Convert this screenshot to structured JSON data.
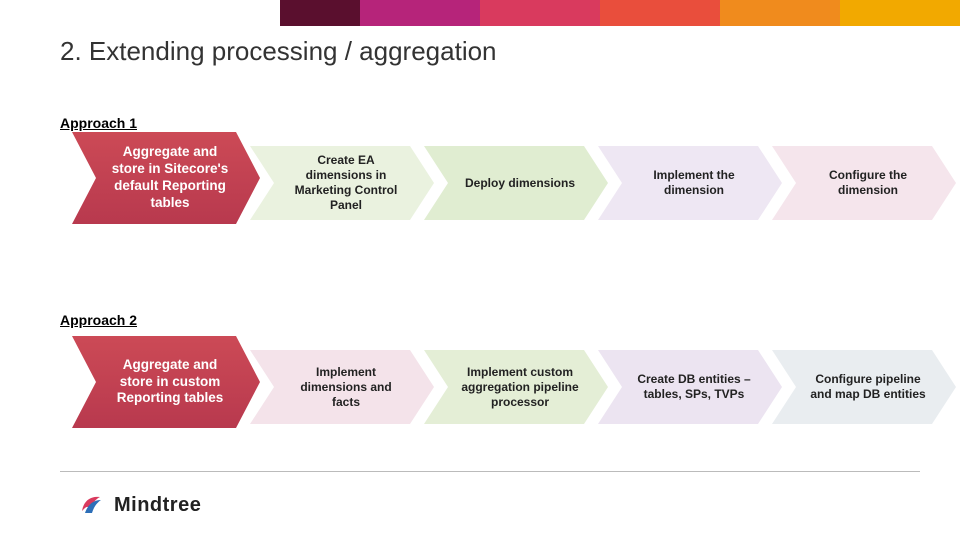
{
  "topband_colors": [
    "#5a0f2e",
    "#b6247a",
    "#d93a5e",
    "#e94e3c",
    "#f08b1d",
    "#f2a900"
  ],
  "title": "2. Extending processing / aggregation",
  "approach1": {
    "label": "Approach 1",
    "steps": [
      "Aggregate and store in Sitecore's default Reporting tables",
      "Create EA dimensions in Marketing Control Panel",
      "Deploy dimensions",
      "Implement the dimension",
      "Configure the dimension"
    ]
  },
  "approach2": {
    "label": "Approach 2",
    "steps": [
      "Aggregate and store in custom Reporting tables",
      "Implement dimensions and facts",
      "Implement custom aggregation pipeline processor",
      "Create DB entities – tables, SPs, TVPs",
      "Configure pipeline and map DB entities"
    ]
  },
  "brand": {
    "name": "Mindtree"
  }
}
